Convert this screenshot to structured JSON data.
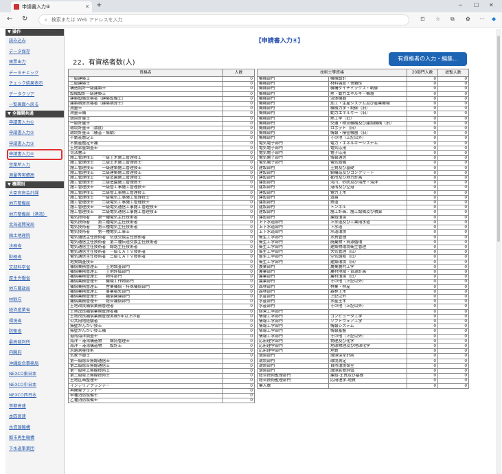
{
  "browser": {
    "tab_title": "申請書入力④",
    "url_placeholder": "検索または Web アドレスを入力"
  },
  "sidebar": {
    "ops_header": "▼ 操作",
    "ops": [
      "読み込み",
      "データ保存",
      "帳票出力",
      "データチェック",
      "チェック結果表示",
      "データクリア",
      "一覧画面へ戻る"
    ],
    "common_header": "▼ 全機関共通",
    "common": [
      "申請書入力①",
      "申請書入力②",
      "申請書入力③",
      "申請書入力④",
      "営業所入力",
      "測量等実績高"
    ],
    "agency_header": "▼ 機関別",
    "agencies": [
      "大臣官房会計課",
      "地方整備局",
      "地方整備局（港湾）",
      "北海道開発局",
      "国土地理院",
      "法務省",
      "財務省",
      "文部科学省",
      "厚生労働省",
      "地方農政局",
      "林野庁",
      "経済産業省",
      "環境省",
      "防衛省",
      "最高裁判所",
      "内閣府",
      "沖縄総合事務局",
      "NEXCO東日本",
      "NEXCO中日本",
      "NEXCO西日本",
      "首都高速",
      "本四高速",
      "水資源機構",
      "都市再生機構",
      "下水道事業団"
    ]
  },
  "main": {
    "page_title": "【申請書入力④】",
    "section_title": "22．有資格者数(人)",
    "edit_button": "有資格者の入力・編集...",
    "left_headers": [
      "資格名",
      "人数"
    ],
    "right_headers": [
      "技術士等資格",
      "",
      "20部門人数",
      "総監人数"
    ],
    "left_rows": [
      [
        "一級建築士",
        "0"
      ],
      [
        "二級建築士",
        "0"
      ],
      [
        "構造設計一級建築士",
        "0"
      ],
      [
        "設備設計一級建築士",
        "0"
      ],
      [
        "建築設備資格者（建築設備士）",
        "0"
      ],
      [
        "建築積算資格者（建築積算士）",
        "0"
      ],
      [
        "測量士",
        "0"
      ],
      [
        "測量士補",
        "0"
      ],
      [
        "環境計量士",
        "0"
      ],
      [
        "一級計量士",
        "0"
      ],
      [
        "環境計量士（濃度）",
        "0"
      ],
      [
        "環境計量士（騒音・振動）",
        "0"
      ],
      [
        "不動産鑑定士",
        "0"
      ],
      [
        "不動産鑑定士補",
        "0"
      ],
      [
        "土地家屋調査士",
        "0"
      ],
      [
        "司法書士",
        "0"
      ],
      [
        "施工管理技士　　一級土木施工管理技士",
        "0"
      ],
      [
        "施工管理技士　　二級土木施工管理技士",
        "0"
      ],
      [
        "施工管理技士　　一級建築施工管理技士",
        "0"
      ],
      [
        "施工管理技士　　二級建築施工管理技士",
        "0"
      ],
      [
        "施工管理技士　　一級造園施工管理技士",
        "0"
      ],
      [
        "施工管理技士　　二級造園施工管理技士",
        "0"
      ],
      [
        "施工管理技士　　一級管工事施工管理技士",
        "0"
      ],
      [
        "施工管理技士　　二級管工事施工管理技士",
        "0"
      ],
      [
        "施工管理技士　　一級電気工事施工管理技士",
        "0"
      ],
      [
        "施工管理技士　　二級電気工事施工管理技士",
        "0"
      ],
      [
        "施工管理技士　　一級電気通信工事施工管理技士",
        "0"
      ],
      [
        "施工管理技士　　二級電気通信工事施工管理技士",
        "0"
      ],
      [
        "電気技術者　　第一種電気主任技術者",
        "0"
      ],
      [
        "電気技術者　　第二種電気主任技術者",
        "0"
      ],
      [
        "電気技術者　　第三種電気主任技術者",
        "0"
      ],
      [
        "電気技術者　　第一種電気工事士",
        "0"
      ],
      [
        "電気通信主任技術者　伝送交換主任技術者",
        "0"
      ],
      [
        "電気通信主任技術者　第二種伝送交換主任技術者",
        "0"
      ],
      [
        "電気通信主任技術者　線路主任技術者",
        "0"
      ],
      [
        "電気通信主任技術者　一級ＣＡＴＶ技術者",
        "0"
      ],
      [
        "電気通信主任技術者　二級ＣＡＴＶ技術者",
        "0"
      ],
      [
        "地質調査技士",
        "0"
      ],
      [
        "補償業務管理士　　土地調査部門",
        "0"
      ],
      [
        "補償業務管理士　　土地評価部門",
        "0"
      ],
      [
        "補償業務管理士　　物件部門",
        "0"
      ],
      [
        "補償業務管理士　　機械工作物部門",
        "0"
      ],
      [
        "補償業務管理士　　営業補償・特殊補償部門",
        "0"
      ],
      [
        "補償業務管理士　　事業損失部門",
        "0"
      ],
      [
        "補償業務管理士　　補償関連部門",
        "0"
      ],
      [
        "補償業務管理士　　総合補償部門",
        "0"
      ],
      [
        "土地改良補償業務管理者",
        "0"
      ],
      [
        "土地改良補償業務管理者補",
        "0"
      ],
      [
        "土地改良補償業務管理実務5年以上の者",
        "0"
      ],
      [
        "公共用地経験者",
        "0"
      ],
      [
        "擁壁かんがい技士",
        "0"
      ],
      [
        "擁壁かんがい技士補",
        "0"
      ],
      [
        "港湾海洋調査士",
        "0"
      ],
      [
        "海洋・港湾構造物　　維持管理士",
        "0"
      ],
      [
        "海洋・港湾構造物　　設計士",
        "0"
      ],
      [
        "水路測量技術",
        "0"
      ],
      [
        "気象予報士",
        "0"
      ],
      [
        "第一級総合無線通信士",
        "0"
      ],
      [
        "第二級総合無線通信士",
        "0"
      ],
      [
        "第一級陸上無線技術士",
        "0"
      ],
      [
        "第二級陸上無線技術士",
        "0"
      ],
      [
        "土地区画整理士",
        "0"
      ],
      [
        "インテリアプランナー",
        "0"
      ],
      [
        "再開発プランナー",
        "0"
      ],
      [
        "甲種消防設備士",
        "0"
      ],
      [
        "乙種消防設備士",
        "0"
      ]
    ],
    "right_rows": [
      [
        "機械部門",
        "機械設計",
        "0",
        "0"
      ],
      [
        "機械部門",
        "材料強度・信頼性",
        "0",
        "0"
      ],
      [
        "機械部門",
        "機構ダイナミックス・制御",
        "0",
        "0"
      ],
      [
        "機械部門",
        "熱・動力エネルギー機器",
        "0",
        "0"
      ],
      [
        "機械部門",
        "流体機器",
        "0",
        "0"
      ],
      [
        "機械部門",
        "加工・生産システム及び産業機械",
        "0",
        "0"
      ],
      [
        "機械部門",
        "機械力学・制御（旧）",
        "0",
        "0"
      ],
      [
        "機械部門",
        "動力エネルギー（旧）",
        "0",
        "0"
      ],
      [
        "機械部門",
        "熱工学（旧）",
        "0",
        "0"
      ],
      [
        "機械部門",
        "交通・物流機械及び建設機械（旧）",
        "0",
        "0"
      ],
      [
        "機械部門",
        "ロボット（旧）",
        "0",
        "0"
      ],
      [
        "機械部門",
        "情報・精密機器（旧）",
        "0",
        "0"
      ],
      [
        "機械部門",
        "その他（上記以外）",
        "0",
        "0"
      ],
      [
        "電気電子部門",
        "電力・エネルギーシステム",
        "0",
        "0"
      ],
      [
        "電気電子部門",
        "電気応用",
        "0",
        "0"
      ],
      [
        "電気電子部門",
        "電子応用",
        "0",
        "0"
      ],
      [
        "電気電子部門",
        "情報通信",
        "0",
        "0"
      ],
      [
        "電気電子部門",
        "電気設備",
        "0",
        "0"
      ],
      [
        "建設部門",
        "土質及び基礎",
        "0",
        "0"
      ],
      [
        "建設部門",
        "鋼構造及びコンクリート",
        "0",
        "0"
      ],
      [
        "建設部門",
        "都市及び地方計画",
        "0",
        "0"
      ],
      [
        "建設部門",
        "河川、砂防及び海岸・海洋",
        "0",
        "0"
      ],
      [
        "建設部門",
        "港湾及び空港",
        "0",
        "0"
      ],
      [
        "建設部門",
        "電力土木",
        "0",
        "0"
      ],
      [
        "建設部門",
        "道路",
        "0",
        "0"
      ],
      [
        "建設部門",
        "鉄道",
        "0",
        "0"
      ],
      [
        "建設部門",
        "トンネル",
        "0",
        "0"
      ],
      [
        "建設部門",
        "施工計画、施工設備及び積算",
        "0",
        "0"
      ],
      [
        "建設部門",
        "建設環境",
        "0",
        "0"
      ],
      [
        "上下水道部門",
        "上水道及び工業用水道",
        "0",
        "0"
      ],
      [
        "上下水道部門",
        "下水道",
        "0",
        "0"
      ],
      [
        "上下水道部門",
        "水道環境",
        "0",
        "0"
      ],
      [
        "衛生工学部門",
        "水質管理",
        "0",
        "0"
      ],
      [
        "衛生工学部門",
        "廃棄物・資源循環",
        "0",
        "0"
      ],
      [
        "衛生工学部門",
        "建築物環境衛生管理",
        "0",
        "0"
      ],
      [
        "衛生工学部門",
        "大気管理（旧）",
        "0",
        "0"
      ],
      [
        "衛生工学部門",
        "空気調和（旧）",
        "0",
        "0"
      ],
      [
        "衛生工学部門",
        "建築環境（旧）",
        "0",
        "0"
      ],
      [
        "農業部門",
        "農業農村工学",
        "0",
        "0"
      ],
      [
        "農業部門",
        "農村地域・資源計画",
        "0",
        "0"
      ],
      [
        "農業部門",
        "農村環境（旧）",
        "0",
        "0"
      ],
      [
        "農業部門",
        "その他（上記以外）",
        "0",
        "0"
      ],
      [
        "森林部門",
        "林業・林産",
        "0",
        "0"
      ],
      [
        "森林部門",
        "森林土木",
        "0",
        "0"
      ],
      [
        "水産部門",
        "上記以外",
        "0",
        "0"
      ],
      [
        "水産部門",
        "水産土木",
        "0",
        "0"
      ],
      [
        "水産部門",
        "その他（上記以外）",
        "0",
        "0"
      ],
      [
        "経営工学部門",
        "",
        "0",
        "0"
      ],
      [
        "情報工学部門",
        "コンピュータ工学",
        "0",
        "0"
      ],
      [
        "情報工学部門",
        "ソフトウェア工学",
        "0",
        "0"
      ],
      [
        "情報工学部門",
        "情報システム",
        "0",
        "0"
      ],
      [
        "情報工学部門",
        "情報基盤",
        "0",
        "0"
      ],
      [
        "情報工学部門",
        "その他（上記以外）",
        "0",
        "0"
      ],
      [
        "応用理学部門",
        "物理及び化学",
        "0",
        "0"
      ],
      [
        "応用理学部門",
        "地球物理及び地球化学",
        "0",
        "0"
      ],
      [
        "応用理学部門",
        "地質",
        "0",
        "0"
      ],
      [
        "環境部門",
        "環境保全計画",
        "0",
        "0"
      ],
      [
        "環境部門",
        "環境測定",
        "0",
        "0"
      ],
      [
        "環境部門",
        "自然環境保全",
        "0",
        "0"
      ],
      [
        "環境部門",
        "環境影響評価",
        "0",
        "0"
      ],
      [
        "総合技術監理部門",
        "建設-土質及び基礎",
        "0",
        "0"
      ],
      [
        "総合技術監理部門",
        "応用理学-地質",
        "0",
        "0"
      ],
      [
        "業人数",
        "",
        "0",
        "0"
      ]
    ]
  }
}
